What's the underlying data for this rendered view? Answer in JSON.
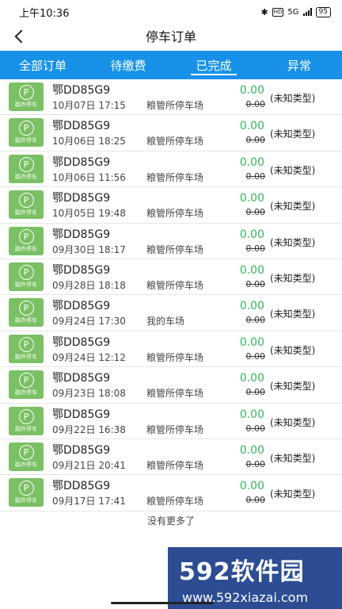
{
  "status_bar": {
    "time": "上午10:36",
    "network": "5G",
    "battery": "95"
  },
  "header": {
    "title": "停车订单"
  },
  "tabs": [
    {
      "label": "全部订单",
      "active": false
    },
    {
      "label": "待缴费",
      "active": false
    },
    {
      "label": "已完成",
      "active": true
    },
    {
      "label": "异常",
      "active": false
    }
  ],
  "logo_text": {
    "symbol": "P",
    "caption": "路外停车"
  },
  "orders": [
    {
      "plate": "鄂DD85G9",
      "time": "10月07日 17:15",
      "lot": "粮管所停车场",
      "amount": "0.00",
      "original": "0.00",
      "type": "(未知类型)"
    },
    {
      "plate": "鄂DD85G9",
      "time": "10月06日 18:25",
      "lot": "粮管所停车场",
      "amount": "0.00",
      "original": "0.00",
      "type": "(未知类型)"
    },
    {
      "plate": "鄂DD85G9",
      "time": "10月06日 11:56",
      "lot": "粮管所停车场",
      "amount": "0.00",
      "original": "0.00",
      "type": "(未知类型)"
    },
    {
      "plate": "鄂DD85G9",
      "time": "10月05日 19:48",
      "lot": "粮管所停车场",
      "amount": "0.00",
      "original": "0.00",
      "type": "(未知类型)"
    },
    {
      "plate": "鄂DD85G9",
      "time": "09月30日 18:17",
      "lot": "粮管所停车场",
      "amount": "0.00",
      "original": "0.00",
      "type": "(未知类型)"
    },
    {
      "plate": "鄂DD85G9",
      "time": "09月28日 18:18",
      "lot": "粮管所停车场",
      "amount": "0.00",
      "original": "0.00",
      "type": "(未知类型)"
    },
    {
      "plate": "鄂DD85G9",
      "time": "09月24日 17:30",
      "lot": "我的车场",
      "amount": "0.00",
      "original": "0.00",
      "type": "(未知类型)"
    },
    {
      "plate": "鄂DD85G9",
      "time": "09月24日 12:12",
      "lot": "粮管所停车场",
      "amount": "0.00",
      "original": "0.00",
      "type": "(未知类型)"
    },
    {
      "plate": "鄂DD85G9",
      "time": "09月23日 18:08",
      "lot": "粮管所停车场",
      "amount": "0.00",
      "original": "0.00",
      "type": "(未知类型)"
    },
    {
      "plate": "鄂DD85G9",
      "time": "09月22日 16:38",
      "lot": "粮管所停车场",
      "amount": "0.00",
      "original": "0.00",
      "type": "(未知类型)"
    },
    {
      "plate": "鄂DD85G9",
      "time": "09月21日 20:41",
      "lot": "粮管所停车场",
      "amount": "0.00",
      "original": "0.00",
      "type": "(未知类型)"
    },
    {
      "plate": "鄂DD85G9",
      "time": "09月17日 17:41",
      "lot": "粮管所停车场",
      "amount": "0.00",
      "original": "0.00",
      "type": "(未知类型)"
    }
  ],
  "footer": {
    "no_more": "没有更多了"
  },
  "watermark": {
    "logo": "592软件园",
    "url": "www.592xiazai.com"
  },
  "colors": {
    "tab_bar": "#1792e8",
    "amount": "#33b85a",
    "logo_bg": "#7ac064",
    "watermark_bg": "#2c4d93"
  }
}
